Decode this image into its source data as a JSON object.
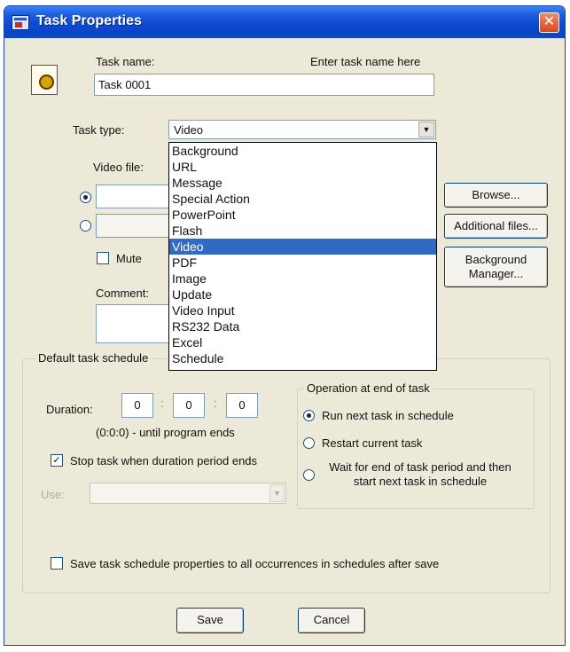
{
  "window": {
    "title": "Task Properties",
    "close_glyph": "✕"
  },
  "task_name": {
    "label": "Task name:",
    "hint": "Enter task name here",
    "value": "Task 0001"
  },
  "task_type": {
    "label": "Task type:",
    "selected": "Video",
    "options": [
      "Background",
      "URL",
      "Message",
      "Special Action",
      "PowerPoint",
      "Flash",
      "Video",
      "PDF",
      "Image",
      "Update",
      "Video Input",
      "RS232 Data",
      "Excel",
      "Schedule"
    ]
  },
  "video_file": {
    "label": "Video file:"
  },
  "mute": {
    "label": "Mute"
  },
  "comment": {
    "label": "Comment:"
  },
  "buttons": {
    "browse": "Browse...",
    "additional_files": "Additional files...",
    "background_manager": "Background Manager...",
    "save": "Save",
    "cancel": "Cancel"
  },
  "schedule": {
    "group_title": "Default task schedule",
    "duration_label": "Duration:",
    "duration_values": [
      "0",
      "0",
      "0"
    ],
    "duration_hint": "(0:0:0) - until program ends",
    "stop_task_label": "Stop task when duration period ends",
    "use_label": "Use:"
  },
  "end_of_task": {
    "title": "Operation at end of task",
    "options": [
      "Run next task in schedule",
      "Restart current task",
      "Wait for end of task period and then start next task in schedule"
    ]
  },
  "save_all": {
    "label": "Save task schedule properties to all occurrences in schedules after save"
  },
  "icons": {
    "checkmark": "✓",
    "dropdown_arrow": "▼"
  }
}
